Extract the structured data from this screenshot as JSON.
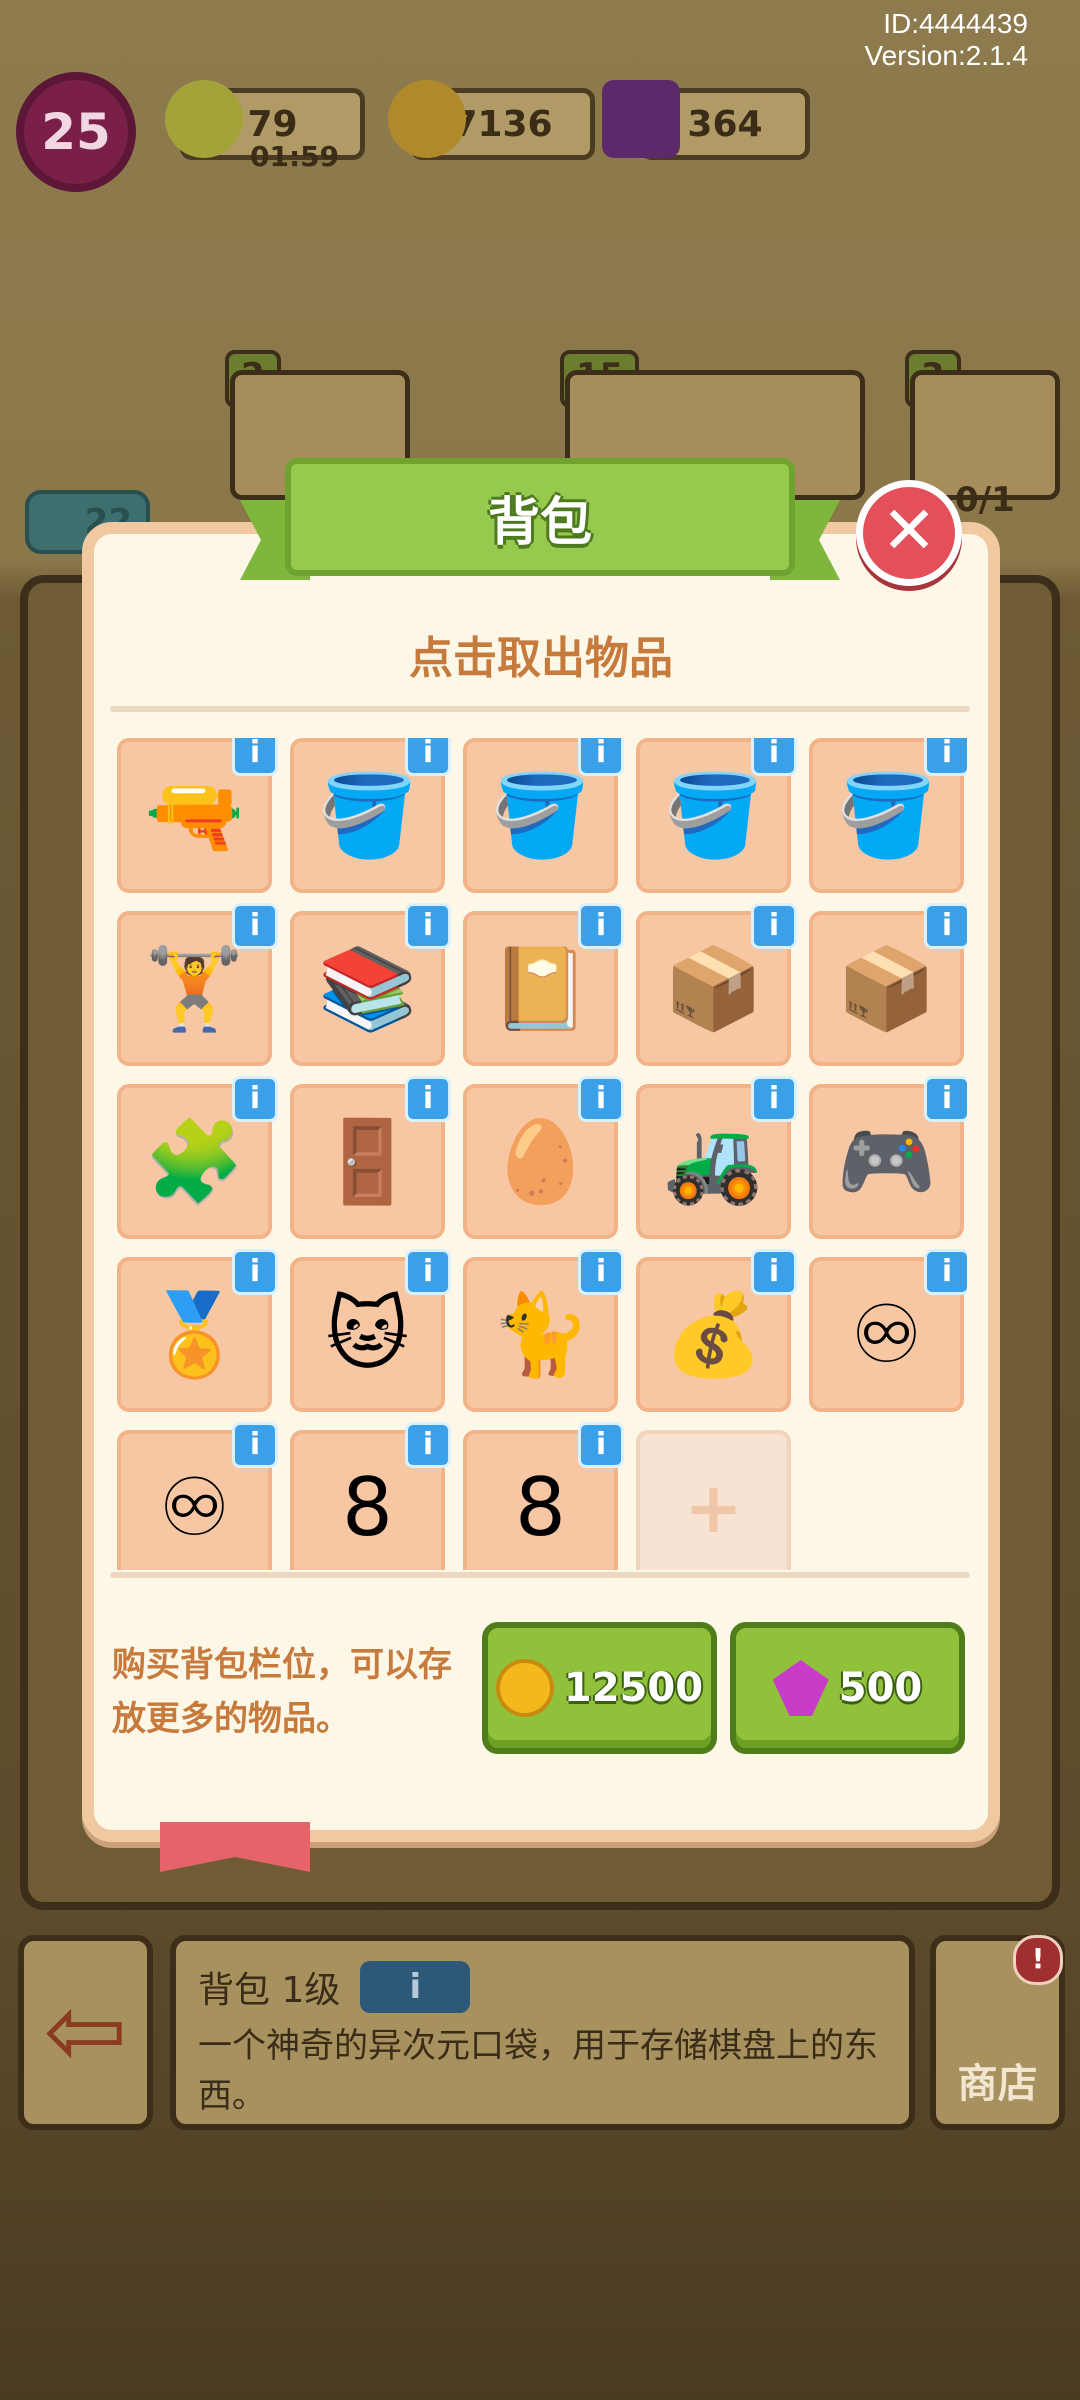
{
  "hud": {
    "user_id": "ID:4444439",
    "version": "Version:2.1.4",
    "level": "25",
    "energy": "79",
    "energy_timer": "01:59",
    "coins": "7136",
    "gems": "364"
  },
  "scene": {
    "star_counts": [
      "2",
      "15",
      "3"
    ],
    "progress": "0/1",
    "left_badge": "22"
  },
  "dialog": {
    "title": "背包",
    "subtitle": "点击取出物品",
    "close_symbol": "✕",
    "info_symbol": "i",
    "items": [
      {
        "name": "drill",
        "glyph": "🔫"
      },
      {
        "name": "paint-bucket",
        "glyph": "🪣"
      },
      {
        "name": "paint-bucket",
        "glyph": "🪣"
      },
      {
        "name": "paint-bucket",
        "glyph": "🪣"
      },
      {
        "name": "paint-bucket",
        "glyph": "🪣"
      },
      {
        "name": "workout-bench",
        "glyph": "🏋"
      },
      {
        "name": "books",
        "glyph": "📚"
      },
      {
        "name": "book-stack",
        "glyph": "📔"
      },
      {
        "name": "cardboard-box",
        "glyph": "📦"
      },
      {
        "name": "open-box",
        "glyph": "📦"
      },
      {
        "name": "puzzle-piece",
        "glyph": "🧩"
      },
      {
        "name": "clock-cabinet",
        "glyph": "🚪"
      },
      {
        "name": "egg-bird",
        "glyph": "🥚"
      },
      {
        "name": "toy-tank",
        "glyph": "🚜"
      },
      {
        "name": "game-console",
        "glyph": "🎮"
      },
      {
        "name": "medal",
        "glyph": "🏅"
      },
      {
        "name": "cat",
        "glyph": "🐱"
      },
      {
        "name": "sleeping-cat",
        "glyph": "🐈"
      },
      {
        "name": "coin-bag",
        "glyph": "💰"
      },
      {
        "name": "green-infinity-hex",
        "glyph": "♾"
      },
      {
        "name": "pink-infinity-hex",
        "glyph": "♾"
      },
      {
        "name": "green-8-hex",
        "glyph": "8"
      },
      {
        "name": "gold-8-hex",
        "glyph": "8"
      }
    ],
    "empty_slot_symbol": "+",
    "buy_text": "购买背包栏位，可以存放更多的物品。",
    "buy_coin_price": "12500",
    "buy_gem_price": "500"
  },
  "info_bar": {
    "title": "背包 1级",
    "info_symbol": "i",
    "description": "一个神奇的异次元口袋，用于存储棋盘上的东西。",
    "exit_symbol": "⇦",
    "shop_label": "商店",
    "shop_badge": "!"
  },
  "colors": {
    "accent_green": "#8fc23a",
    "close_red": "#e3505a",
    "text_orange": "#c67a3c",
    "cell_bg": "#f7c7a4",
    "info_blue": "#3aa0e8"
  }
}
